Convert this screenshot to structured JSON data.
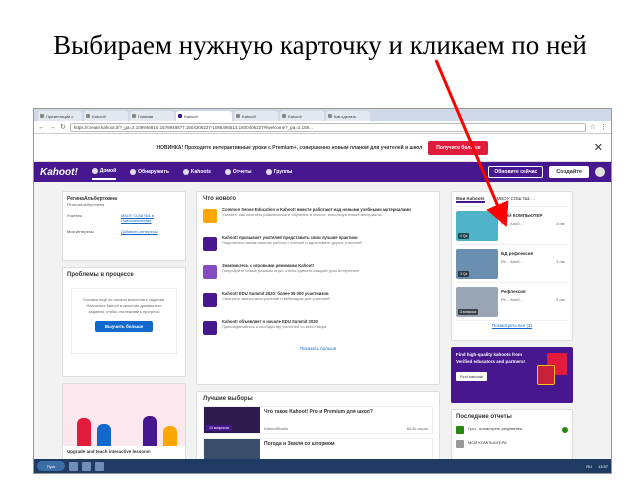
{
  "slide": {
    "title": "Выбираем нужную карточку и кликаем по ней"
  },
  "browser": {
    "tabs": [
      "Презентации с",
      "Kahoot!",
      "Главная",
      "Kahoot!",
      "Kahoot!",
      "Kahoot!",
      "Как сделать"
    ],
    "url": "https://create.kahoot.it/?_ga=2.109946810.1578948877.1604306227-1086496513.1600406227#/welcome?_ga=2.159..."
  },
  "banner": {
    "text": "НОВИНКА! Проходите интерактивные уроки с Premium+, совершенно новым планом для учителей и школ",
    "button": "Получите больше",
    "close": "✕"
  },
  "kahoot_nav": {
    "logo": "Kahoot!",
    "items": [
      "Домой",
      "Обнаружить",
      "Kahoots",
      "Отчеты",
      "Группы"
    ],
    "right_link": "Обновите сейчас",
    "create": "Создайте"
  },
  "profile": {
    "name": "РегинаАльбертовна",
    "username": "РегинаАльбертовна",
    "teacher_label": "Учитель",
    "school": "МБОУ СОШ №1 в Новоалексеевке",
    "interests_label": "Мои интересы",
    "interests_link": "Добавить интересы"
  },
  "progress_card": {
    "title": "Проблемы в процессе",
    "body": "Ученики ещё не начали выполнять задания. Назначьте kahoot в качестве домашнего задания, чтобы отслеживать прогресс",
    "button": "Выучить больше"
  },
  "promo": {
    "text": "Upgrade and teach interactive lessons!"
  },
  "news": {
    "title": "Что нового",
    "items": [
      {
        "title": "Common Sense Education и Kahoot! вместе работают над новыми учебными материалами",
        "body": "Узнайте, как сочетать развлечения и обучение в классе, используя новые материалы"
      },
      {
        "title": "Kahoot! призывает учителей представить свои лучшие практики",
        "body": "Поделитесь своим опытом работы с Kahoot! и вдохновите других учителей"
      },
      {
        "title": "Знакомьтесь с игровыми режимами Kahoot!",
        "body": "Попробуйте новые режимы игры, чтобы сделать каждый урок интереснее"
      },
      {
        "title": "Kahoot! EDU Summit 2020: более 35 000 участников",
        "body": "Смотрите записи выступлений и вебинаров для учителей"
      },
      {
        "title": "Kahoot! объявляет о начале EDU Summit 2020",
        "body": "Присоединяйтесь к сообществу учителей со всего мира"
      }
    ],
    "show_more": "Показать больше"
  },
  "best": {
    "title": "Лучшие выборы",
    "items": [
      {
        "title": "Что такое Kahoot! Pro и Premium для школ?",
        "badge": "10 вопросов",
        "author": "KahootStudio",
        "plays": "80.4k играл"
      },
      {
        "title": "Погода и Земля со штормом",
        "badge": "",
        "author": "",
        "plays": ""
      }
    ]
  },
  "my_kahoots": {
    "tabs": [
      "Мои Kahoots",
      "МБОУ СОШ №1 ..."
    ],
    "items": [
      {
        "title": "МОЙ КОМПЬЮТЕР",
        "count": "4 Qs",
        "meta_left": "Ре... Альб...",
        "meta_right": "3 гвс"
      },
      {
        "title": "БД рефлексия",
        "count": "3 Qs",
        "meta_left": "Ре... Альб...",
        "meta_right": "3 гвс"
      },
      {
        "title": "Рефлексия",
        "count": "3 вопроса",
        "meta_left": "Ре... Альб...",
        "meta_right": "3 гвс"
      }
    ],
    "see_all": "Посмотреть все (3)"
  },
  "ad": {
    "text": "Find high-quality kahoots from Verified educators and partners!",
    "button": "Find kahoots"
  },
  "reports": {
    "title": "Последние отчеты",
    "items": [
      {
        "text": "Гугл - посмотреть результаты"
      },
      {
        "text": "МОЙ КОМПЬЮТЕРА"
      }
    ]
  },
  "taskbar": {
    "start": "Пуск",
    "lang": "RU",
    "time": "13:57"
  },
  "colors": {
    "kahoot_purple": "#46178f",
    "accent_red": "#e21b3c",
    "annotation_red": "#ff0000",
    "link_blue": "#1368ce"
  }
}
